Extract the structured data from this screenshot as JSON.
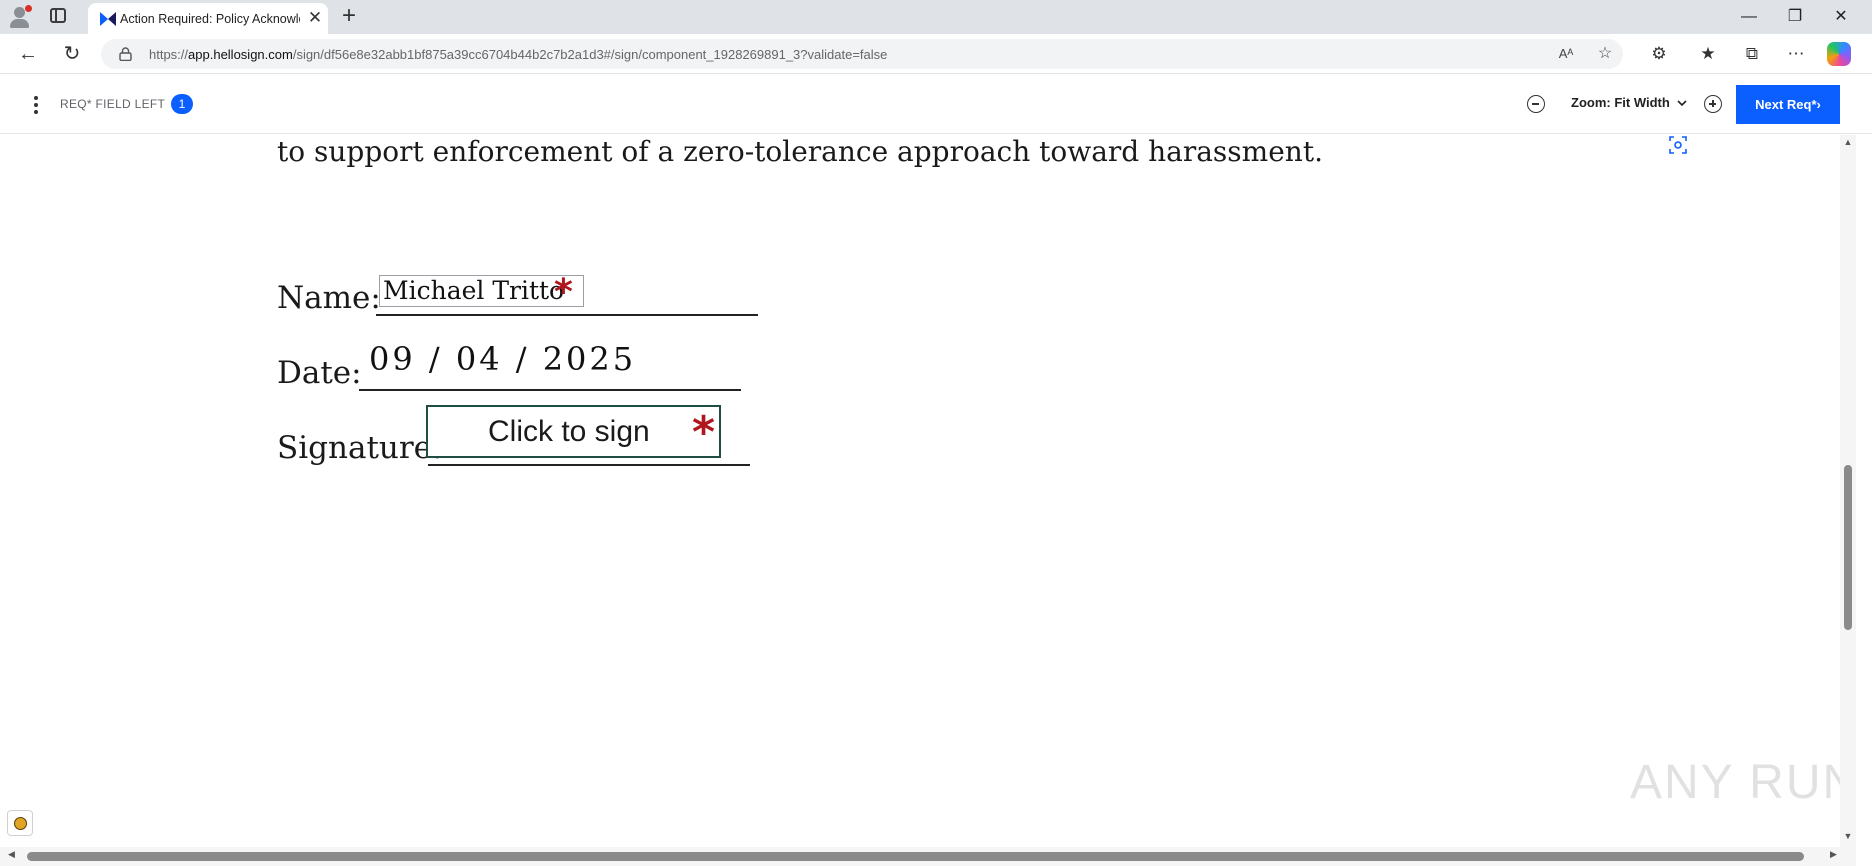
{
  "browser": {
    "tab": {
      "title": "Action Required: Policy Acknowledgement",
      "favicon": "hellosign-favicon-icon",
      "close_glyph": "✕"
    },
    "new_tab_glyph": "+",
    "window_controls": {
      "minimize": "—",
      "restore": "❐",
      "close": "✕"
    },
    "url": {
      "scheme": "https://",
      "host": "app.hellosign.com",
      "path": "/sign/df56e8e32abb1bf875a39cc6704b44b2c7b2a1d3#/sign/component_1928269891_3?validate=false"
    },
    "icons": [
      "back-icon",
      "refresh-icon",
      "lock-icon",
      "read-aloud-icon",
      "favorite-star-icon",
      "extensions-icon",
      "favorites-icon",
      "collections-icon",
      "more-icon",
      "copilot-icon"
    ]
  },
  "app_toolbar": {
    "required_label": "REQ* FIELD LEFT",
    "required_count": "1",
    "zoom_label": "Zoom: Fit Width",
    "next_button": "Next Req*"
  },
  "document": {
    "top_text": "to support enforcement of a zero-tolerance approach toward harassment.",
    "name_label": "Name:",
    "name_value": "Michael Tritto",
    "date_label": "Date:",
    "date_value": "09 / 04 / 2025",
    "signature_label": "Signature:",
    "signature_placeholder": "Click to sign",
    "required_marker": "*"
  },
  "watermark": "ANY RUN",
  "colors": {
    "primary_button": "#0b5fff",
    "required_star": "#b0161e",
    "signature_border": "#1f4d43"
  }
}
